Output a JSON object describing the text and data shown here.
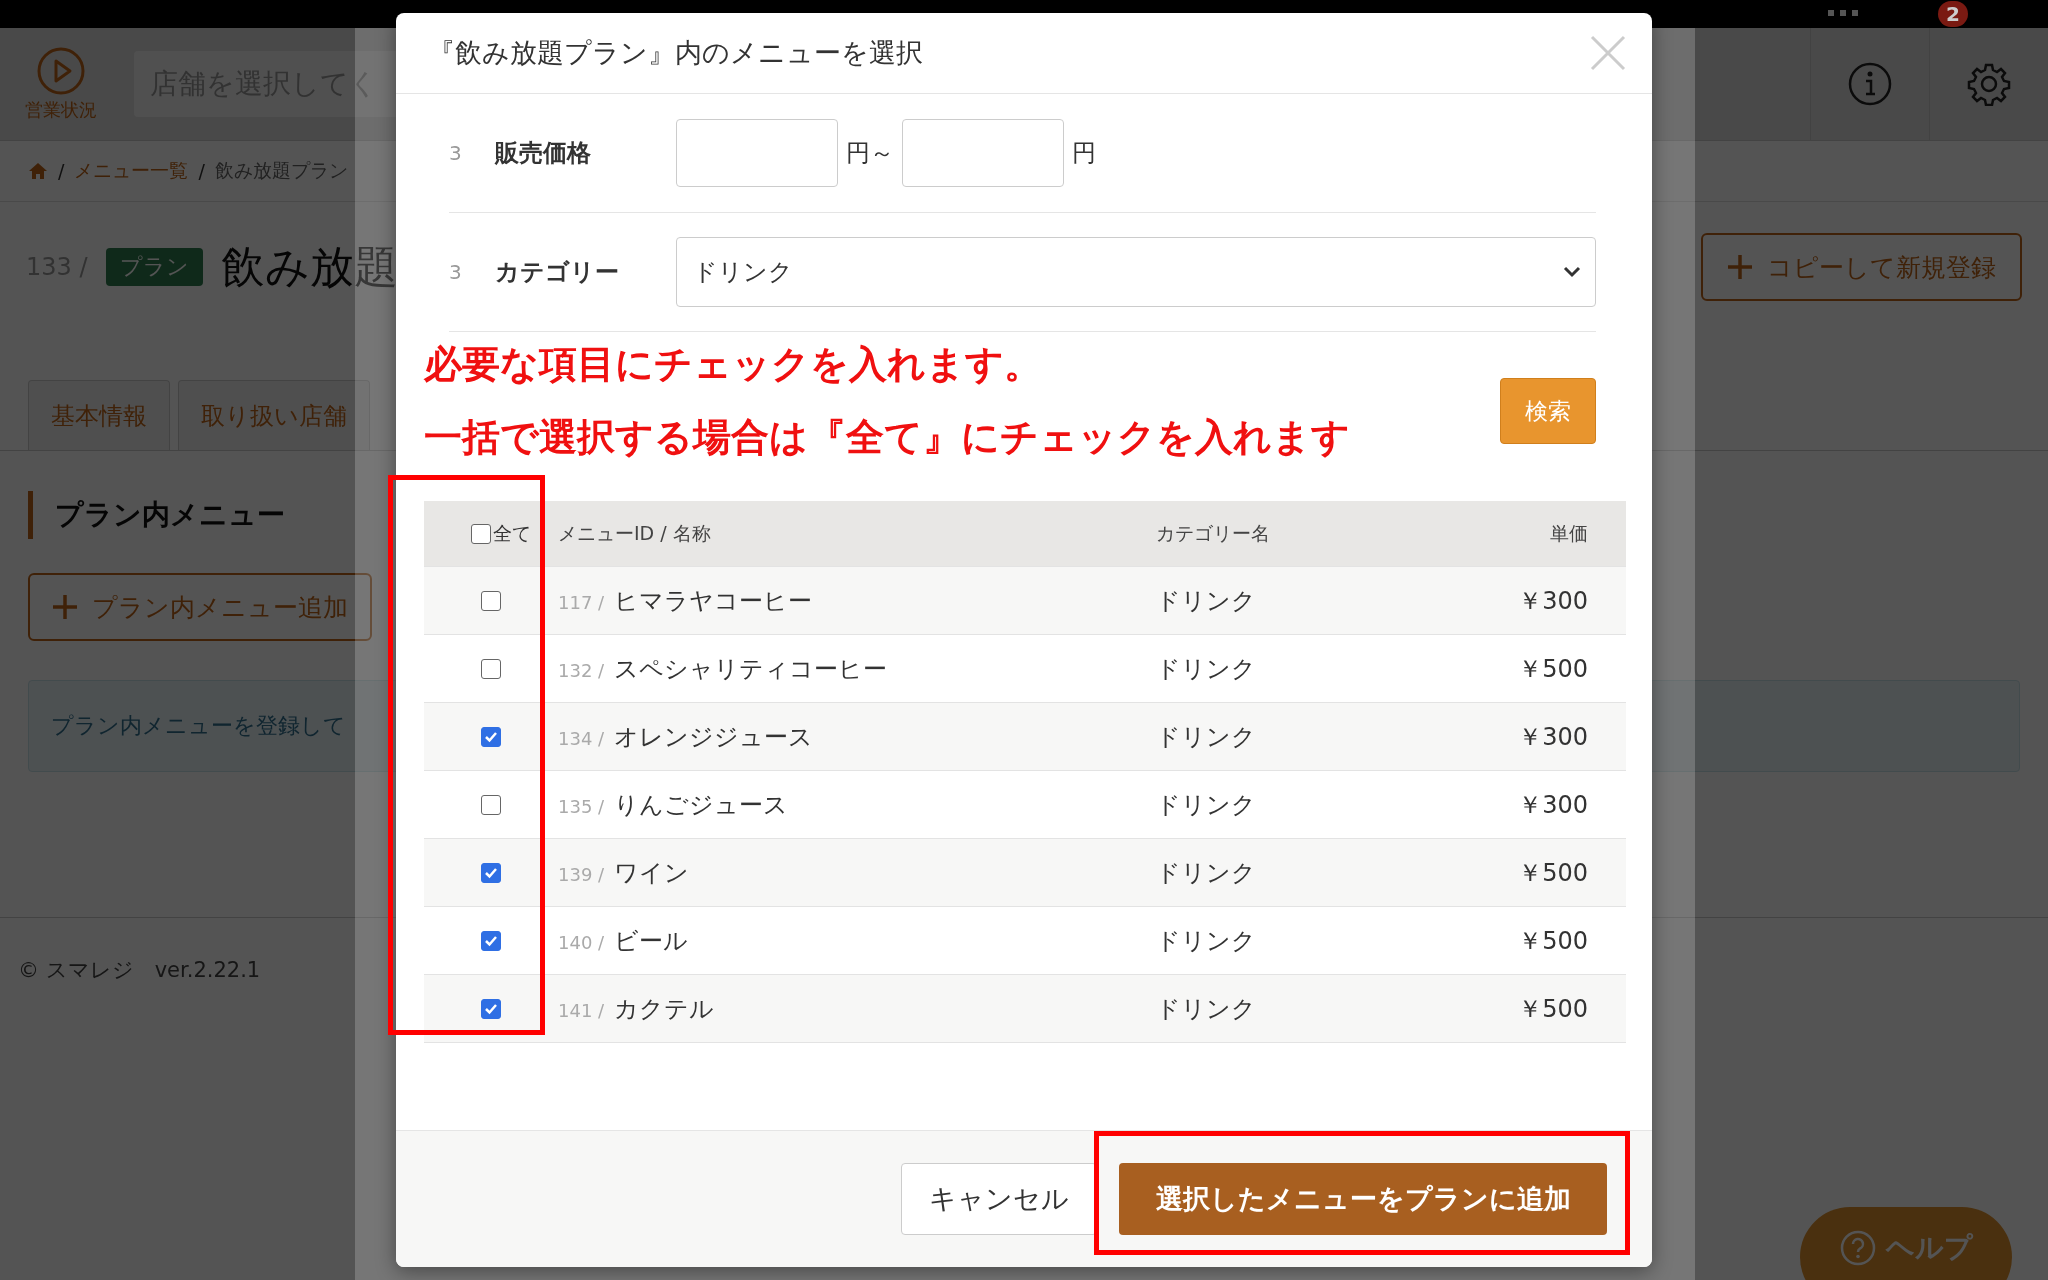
{
  "top_bar": {
    "notification_count": "2"
  },
  "header": {
    "status_label": "営業状況",
    "store_select": {
      "placeholder": "店舗を選択してく"
    }
  },
  "breadcrumb": [
    {
      "separator": "/",
      "label": "メニュー一覧"
    },
    {
      "separator": "/",
      "label": "飲み放題プラン"
    }
  ],
  "page_title": {
    "id": "133 /",
    "badge": "プラン",
    "title": "飲み放題"
  },
  "copy_button": "コピーして新規登録",
  "tabs": [
    {
      "label": "基本情報",
      "selected": false
    },
    {
      "label": "取り扱い店舗",
      "selected": false
    }
  ],
  "section": {
    "title": "プラン内メニュー",
    "add_button": "プラン内メニュー追加",
    "notice": "プラン内メニューを登録して"
  },
  "footer": "© スマレジ　ver.2.22.1",
  "help_button": "ヘルプ",
  "modal": {
    "title": "『飲み放題プラン』内のメニューを選択",
    "filters": [
      {
        "kind": "range",
        "number": "3",
        "label": "販売価格",
        "from_unit": "円～",
        "to_unit": "円"
      },
      {
        "kind": "select",
        "number": "3",
        "label": "カテゴリー",
        "value": "ドリンク"
      }
    ],
    "search_button": "検索",
    "table": {
      "select_all": {
        "label": "全て",
        "checked": false
      },
      "columns": [
        "メニューID / 名称",
        "カテゴリー名",
        "単価"
      ],
      "rows": [
        {
          "checked": false,
          "id": "117 /",
          "name": "ヒマラヤコーヒー",
          "category": "ドリンク",
          "price": "￥300"
        },
        {
          "checked": false,
          "id": "132 /",
          "name": "スペシャリティコーヒー",
          "category": "ドリンク",
          "price": "￥500"
        },
        {
          "checked": true,
          "id": "134 /",
          "name": "オレンジジュース",
          "category": "ドリンク",
          "price": "￥300"
        },
        {
          "checked": false,
          "id": "135 /",
          "name": "りんごジュース",
          "category": "ドリンク",
          "price": "￥300"
        },
        {
          "checked": true,
          "id": "139 /",
          "name": "ワイン",
          "category": "ドリンク",
          "price": "￥500"
        },
        {
          "checked": true,
          "id": "140 /",
          "name": "ビール",
          "category": "ドリンク",
          "price": "￥500"
        },
        {
          "checked": true,
          "id": "141 /",
          "name": "カクテル",
          "category": "ドリンク",
          "price": "￥500"
        }
      ]
    },
    "cancel_button": "キャンセル",
    "submit_button": "選択したメニューをプランに追加"
  },
  "annotations": [
    "必要な項目にチェックを入れます。",
    "一括で選択する場合は『全て』にチェックを入れます"
  ]
}
